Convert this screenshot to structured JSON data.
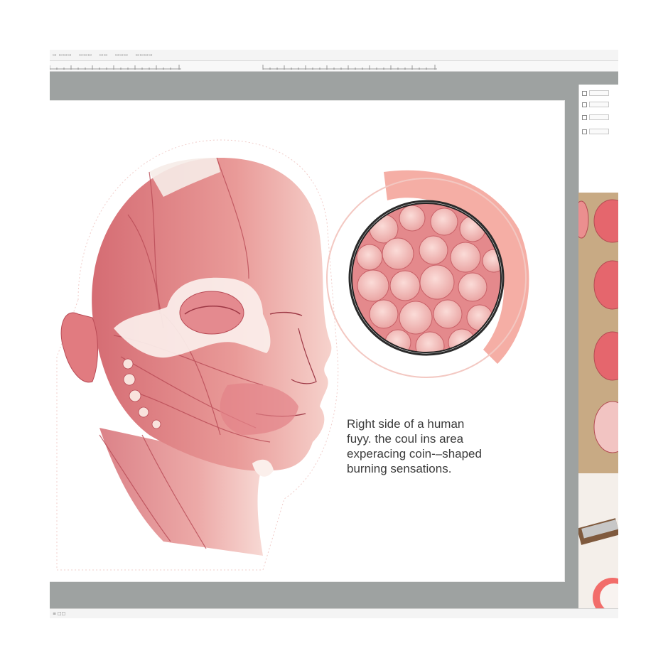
{
  "menubar": {
    "items": [
      {
        "label": "▭ ▭▭▭"
      },
      {
        "label": "▭▭▭"
      },
      {
        "label": "▭▭"
      },
      {
        "label": "▭▭▭"
      },
      {
        "label": "▭▭▭▭"
      }
    ]
  },
  "caption": {
    "line1": "Right side of a human",
    "line2": "fuyy. the coul ins area",
    "line3": "experacing coin-–shaped",
    "line4": "burning sensations."
  },
  "status": {
    "text": "≡ □□"
  },
  "colors": {
    "app_gray": "#9ea2a1",
    "muscle": "#d9757a",
    "muscle_light": "#f0b1ad",
    "accent_coral": "#f08a7d",
    "paper": "#ffffff"
  },
  "icons": [
    "illustration-face",
    "magnifier-circle",
    "ruler",
    "property-panel",
    "photo-strip"
  ]
}
